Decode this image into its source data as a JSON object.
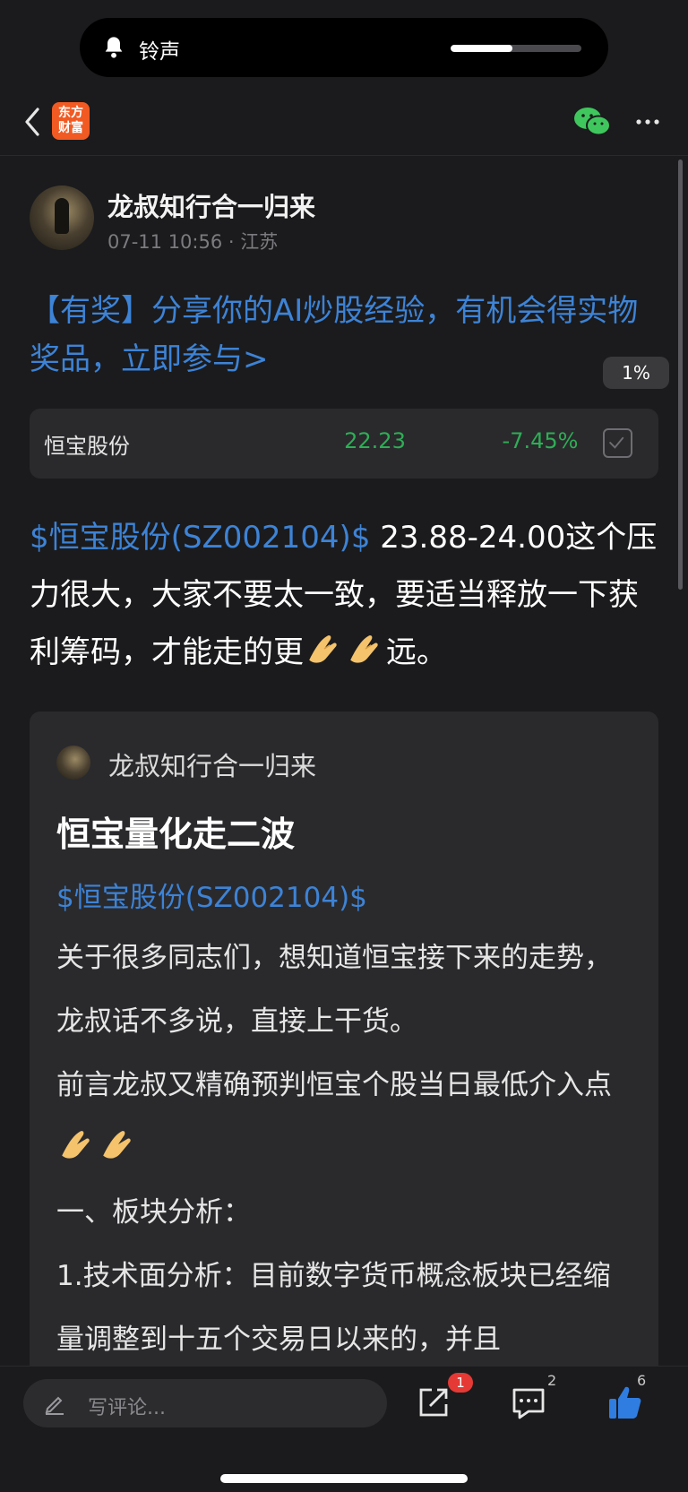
{
  "notification": {
    "label": "铃声",
    "volume_fraction": 0.47
  },
  "nav": {
    "logo_line1": "东方",
    "logo_line2": "财富"
  },
  "author": {
    "name": "龙叔知行合一归来",
    "time": "07-11 10:56",
    "location": "江苏"
  },
  "promo": {
    "text": "【有奖】分享你的AI炒股经验，有机会得实物奖品，立即参与>"
  },
  "read_progress": "1%",
  "stock_card": {
    "name": "恒宝股份",
    "price": "22.23",
    "change": "-7.45%"
  },
  "post": {
    "tag": "$恒宝股份(SZ002104)$",
    "text_before": " 23.88-24.00这个压力很大，大家不要太一致，要适当释放一下获利筹码，才能走的更",
    "text_after": "远。"
  },
  "quote": {
    "author": "龙叔知行合一归来",
    "title": "恒宝量化走二波",
    "tag": "$恒宝股份(SZ002104)$",
    "p1": "关于很多同志们，想知道恒宝接下来的走势，龙叔话不多说，直接上干货。",
    "p2": "前言龙叔又精确预判恒宝个股当日最低介入点",
    "p3": "一、板块分析：",
    "p4": "1.技术面分析：目前数字货币概念板块已经缩量调整到十五个交易日以来的，并且"
  },
  "bottom": {
    "comment_placeholder": "写评论...",
    "share_badge": "1",
    "comment_count": "2",
    "like_count": "6"
  },
  "colors": {
    "link": "#3d83d6",
    "down": "#2eae55",
    "accent": "#f15a22",
    "like": "#2f7de1"
  }
}
